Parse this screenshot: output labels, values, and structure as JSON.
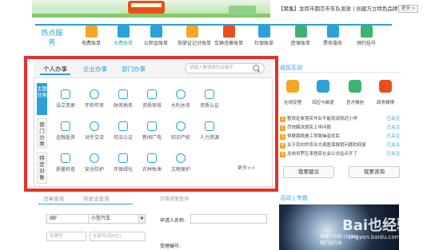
{
  "header": {
    "news_text": "【聚集】龙岗市圆京市车队发放 | 创建万立特色品牌岗 ...",
    "more_label": "更多 >"
  },
  "hot_services": {
    "label": "热点服务",
    "items": [
      {
        "label": "电费账单",
        "icon": "lightning-icon",
        "color": "#f5a623"
      },
      {
        "label": "水费账单",
        "icon": "water-drop-icon",
        "color": "#2aa1d8"
      },
      {
        "label": "公积金账单",
        "icon": "home-icon",
        "color": "#2aa1d8"
      },
      {
        "label": "驾驶证记分账单",
        "icon": "id-card-icon",
        "color": "#f5a623"
      },
      {
        "label": "车辆违章账单",
        "icon": "car-icon",
        "color": "#e94e1b"
      },
      {
        "label": "社保账单",
        "icon": "leaf-icon",
        "color": "#2aa1d8"
      },
      {
        "label": "医保账单",
        "icon": "camera-icon",
        "color": "#3cb371"
      },
      {
        "label": "票务服务",
        "icon": "ticket-icon",
        "color": "#2aa1d8"
      },
      {
        "label": "预约挂号",
        "icon": "grid-icon",
        "color": "#3cb371"
      }
    ]
  },
  "service_tabs": {
    "personal": "个人办事",
    "business": "企业办事",
    "department": "部门办事",
    "search_placeholder": "请输入要搜索的关键字"
  },
  "side_tabs": [
    {
      "label": "主题分类"
    },
    {
      "label": "部门分类"
    },
    {
      "label": "特定对象"
    }
  ],
  "categories": [
    {
      "label": "设立变更",
      "icon": "cube-icon"
    },
    {
      "label": "年检年审",
      "icon": "calendar-icon"
    },
    {
      "label": "财务税务",
      "icon": "building-icon"
    },
    {
      "label": "资质审核",
      "icon": "vehicle-icon"
    },
    {
      "label": "水利水务",
      "icon": "faucet-icon"
    },
    {
      "label": "资质认证",
      "icon": "certificate-icon"
    },
    {
      "label": "金融投资",
      "icon": "coin-icon"
    },
    {
      "label": "对外交流",
      "icon": "handshake-icon"
    },
    {
      "label": "司法公证",
      "icon": "hammer-icon"
    },
    {
      "label": "新闻广电",
      "icon": "satellite-icon"
    },
    {
      "label": "知识产权",
      "icon": "book-icon"
    },
    {
      "label": "人力资源",
      "icon": "people-icon"
    },
    {
      "label": "质量检查",
      "icon": "box-icon"
    },
    {
      "label": "安全防护",
      "icon": "shield-icon"
    },
    {
      "label": "环保绿化",
      "icon": "tree-icon"
    },
    {
      "label": "农林牧渔",
      "icon": "ship-icon"
    },
    {
      "label": "文物保护",
      "icon": "vase-icon"
    }
  ],
  "more_categories": "更多>>",
  "interaction": {
    "title": "政民互动",
    "items": [
      {
        "label": "在线受理",
        "icon": "online-icon",
        "color": "#f5a623"
      },
      {
        "label": "回应与邮递",
        "icon": "mail-icon",
        "color": "#2aa1d8"
      },
      {
        "label": "官方微信",
        "icon": "wechat-icon",
        "color": "#3cb371"
      },
      {
        "label": "政务微博",
        "icon": "weibo-icon",
        "color": "#e94e1b"
      }
    ],
    "questions": [
      {
        "num": "1",
        "text": "整改征收落实作业不能就读就近小学",
        "status": "已关注"
      },
      {
        "num": "2",
        "text": "尽快解决居民上学问题",
        "status": "已关注"
      },
      {
        "num": "3",
        "text": "恒联路段施工导致噪音扰民",
        "status": "已关注"
      },
      {
        "num": "4",
        "text": "关于农村的农合大病医保报销问题的回复",
        "status": "已关注"
      },
      {
        "num": "5",
        "text": "龙岗何罗区来居民社会公交站点开了",
        "status": "已关注"
      }
    ],
    "ask_button": "我要建议",
    "consult_button": "我要咨询"
  },
  "vehicle_query": {
    "tab1": "违章查询",
    "tab2": "驾驶证查询",
    "province": "闽F",
    "car_type": "小型汽车",
    "plate_placeholder": "车牌号",
    "engine_placeholder": "车架号(后6位)"
  },
  "application_form": {
    "title": "办事进度查询",
    "applicant_label": "申请人名称:",
    "number_label": "受理编号:"
  },
  "activity": {
    "title": "活动 | 专题",
    "caption": "地球一小时 (2015)  — 我们在行动",
    "watermark": "Bai也经验",
    "watermark_sub": "jingyan.baidu.com"
  }
}
